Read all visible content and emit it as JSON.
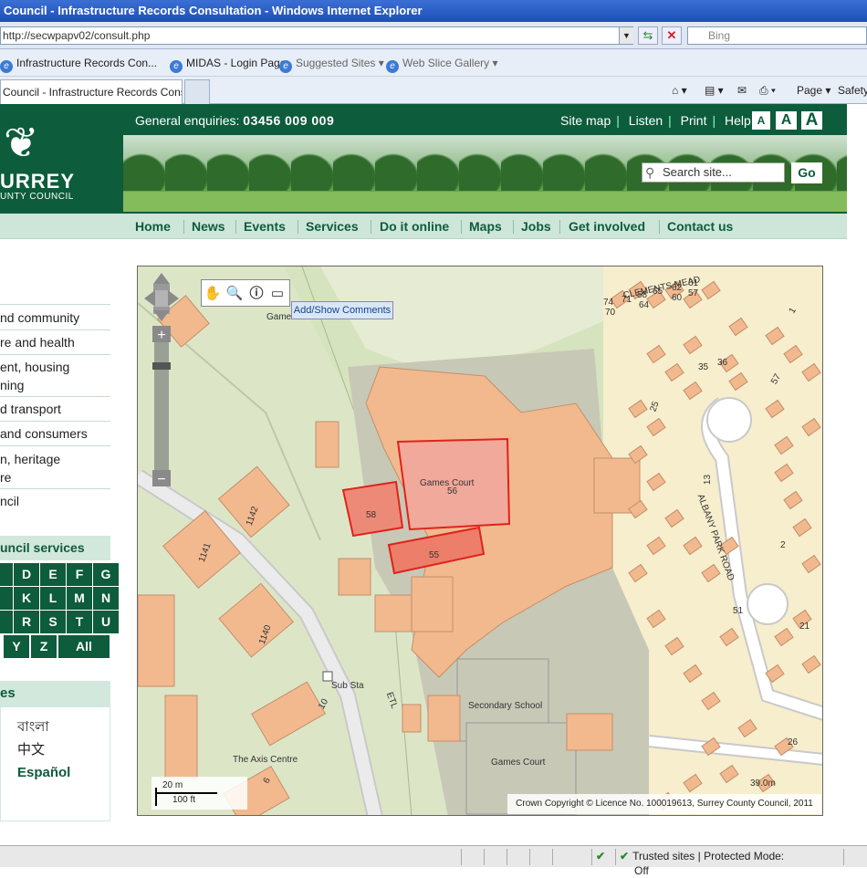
{
  "browser": {
    "title": "Council - Infrastructure Records Consultation - Windows Internet Explorer",
    "url": "http://secwpapv02/consult.php",
    "search_provider": "Bing",
    "favorites": [
      {
        "label": "Infrastructure Records Con...",
        "icon": "ie-icon"
      },
      {
        "label": "MIDAS - Login Page",
        "icon": "ie-icon"
      },
      {
        "label": "Suggested Sites ▾",
        "icon": "ie-icon"
      },
      {
        "label": "Web Slice Gallery ▾",
        "icon": "ie-icon"
      }
    ],
    "tab_label": "Council - Infrastructure Records Cons...",
    "commands": {
      "page": "Page ▾",
      "safety": "Safety"
    },
    "status": {
      "zone": "Trusted sites | Protected Mode: Off"
    }
  },
  "header": {
    "enquiries_label": "General enquiries:",
    "enquiries_phone": "03456 009 009",
    "toplinks": [
      "Site map",
      "Listen",
      "Print",
      "Help"
    ],
    "font_sizes": [
      "A",
      "A",
      "A"
    ],
    "logo_title": "URREY",
    "logo_subtitle": "UNTY COUNCIL",
    "search_placeholder": "Search site...",
    "go_label": "Go"
  },
  "nav": [
    "Home",
    "News",
    "Events",
    "Services",
    "Do it online",
    "Maps",
    "Jobs",
    "Get involved",
    "Contact us"
  ],
  "sidebar": {
    "items": [
      "nd community",
      "re and health",
      "ent, housing\nning",
      "d transport",
      "and consumers",
      "n, heritage\nre",
      "ncil"
    ],
    "services_heading": "uncil services",
    "az": [
      [
        "",
        "D",
        "E",
        "F",
        "G"
      ],
      [
        "",
        "K",
        "L",
        "M",
        "N"
      ],
      [
        "",
        "R",
        "S",
        "T",
        "U"
      ],
      [
        "Y",
        "Z",
        "All"
      ]
    ],
    "languages_heading": "es",
    "languages": [
      "বাংলা",
      "中文",
      "Español"
    ]
  },
  "map": {
    "tooltip": "Add/Show Comments",
    "scale_metric": "20 m",
    "scale_imperial": "100 ft",
    "copyright": "Crown Copyright © Licence No. 100019613, Surrey County Council, 2011",
    "labels": {
      "games_court_top": "Games Court",
      "games_court_top_num": "56",
      "p58": "58",
      "p55": "55",
      "secondary_school": "Secondary School",
      "games_court_bottom": "Games Court",
      "sub_sta": "Sub Sta",
      "axis_centre": "The Axis Centre",
      "albany_park_road": "ALBANY PARK ROAD",
      "clements_mead": "CLEMENTS MEAD",
      "etl": "ETL",
      "game": "Game",
      "n1142": "1142",
      "n1141": "1141",
      "n1140": "1140",
      "n10": "10",
      "n6": "6",
      "n39": "39.0m",
      "n51": "51",
      "n21": "21",
      "n26": "26",
      "n25": "25",
      "n13": "13",
      "n2": "2",
      "n35": "35",
      "n36": "36",
      "n57": "57",
      "n1": "1",
      "house_nums": [
        "74",
        "71",
        "58",
        "65",
        "62",
        "61",
        "70",
        "64",
        "60",
        "57"
      ]
    },
    "highlight_color": "#e8472a"
  }
}
